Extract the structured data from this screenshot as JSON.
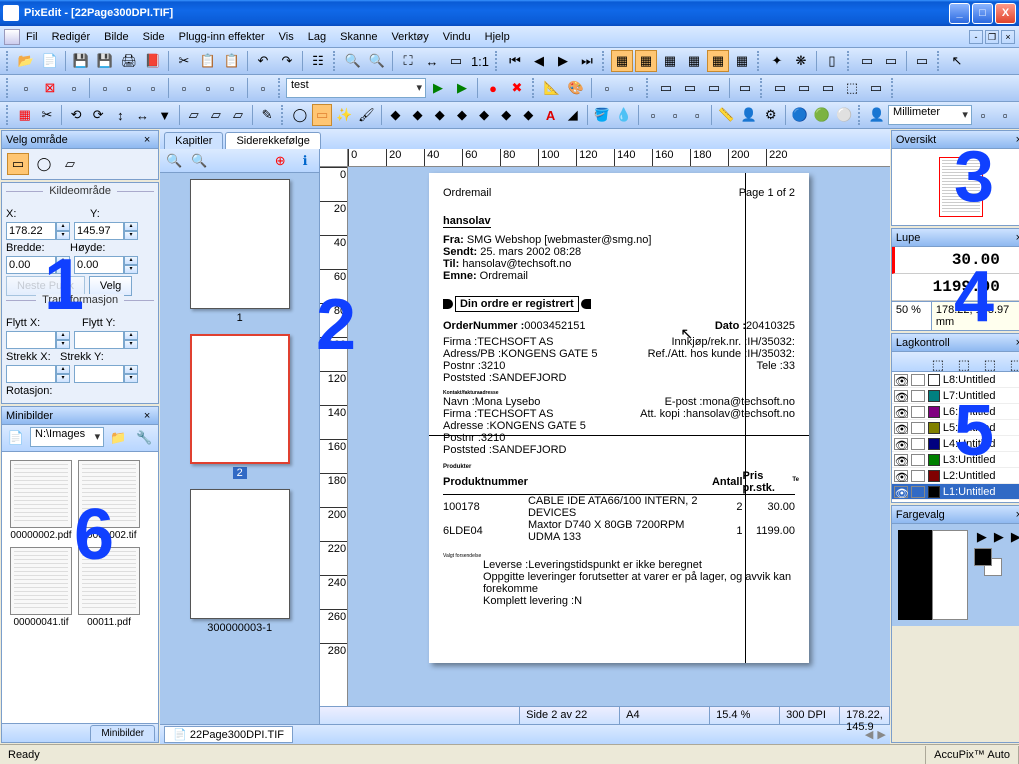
{
  "window": {
    "title": "PixEdit - [22Page300DPI.TIF]"
  },
  "menu": [
    "Fil",
    "Redigér",
    "Bilde",
    "Side",
    "Plugg-inn effekter",
    "Vis",
    "Lag",
    "Skanne",
    "Verktøy",
    "Vindu",
    "Hjelp"
  ],
  "toolbar3_combo": "test",
  "toolbar4_units": "Millimeter",
  "panels": {
    "selectarea": {
      "title": "Velg område"
    },
    "source": {
      "title": "Kildeområde",
      "x_label": "X:",
      "y_label": "Y:",
      "x": "178.22",
      "y": "145.97",
      "w_label": "Bredde:",
      "h_label": "Høyde:",
      "w": "0.00",
      "h": "0.00",
      "next": "Neste Punk",
      "pick": "Velg"
    },
    "transform": {
      "title": "Transformasjon",
      "fx_label": "Flytt X:",
      "fy_label": "Flytt Y:",
      "sx_label": "Strekk X:",
      "sy_label": "Strekk Y:",
      "rot_label": "Rotasjon:"
    },
    "minibilder": {
      "title": "Minibilder",
      "path": "N:\\Images",
      "files": [
        "00000002.pdf",
        "00000002.tif",
        "00000041.tif",
        "00011.pdf"
      ],
      "tab": "Minibilder"
    },
    "tabs": {
      "kapitler": "Kapitler",
      "siderekke": "Siderekkefølge"
    },
    "oversikt": {
      "title": "Oversikt"
    },
    "lupe": {
      "title": "Lupe",
      "v1": "30.00",
      "v2": "1199.00",
      "zoom": "50 %",
      "coord": "178.22, 145.97 mm"
    },
    "lagkontroll": {
      "title": "Lagkontroll",
      "layers": [
        {
          "name": "L8:Untitled",
          "color": "#ffffff"
        },
        {
          "name": "L7:Untitled",
          "color": "#008080"
        },
        {
          "name": "L6:Untitled",
          "color": "#800080"
        },
        {
          "name": "L5:Untitled",
          "color": "#808000"
        },
        {
          "name": "L4:Untitled",
          "color": "#000080"
        },
        {
          "name": "L3:Untitled",
          "color": "#008000"
        },
        {
          "name": "L2:Untitled",
          "color": "#800000"
        },
        {
          "name": "L1:Untitled",
          "color": "#000000"
        }
      ]
    },
    "fargevalg": {
      "title": "Fargevalg"
    }
  },
  "pagestrip": {
    "pages": [
      "1",
      "2",
      "300000003-1"
    ],
    "selected": 1
  },
  "document": {
    "header": {
      "title": "Ordremail",
      "page": "Page 1 of 2"
    },
    "to": "hansolav",
    "fields": [
      [
        "Fra:",
        "SMG Webshop [webmaster@smg.no]"
      ],
      [
        "Sendt:",
        "25. mars 2002 08:28"
      ],
      [
        "Til:",
        "hansolav@techsoft.no"
      ],
      [
        "Emne:",
        "Ordremail"
      ]
    ],
    "banner": "Din ordre er registrert",
    "ordernr_label": "OrderNummer :",
    "ordernr": "0003452151",
    "date_label": "Dato :",
    "date": "20410325",
    "firm_lines": [
      "Firma :TECHSOFT AS",
      "Adress/PB :KONGENS GATE 5",
      "Postnr :3210",
      "Poststed :SANDEFJORD"
    ],
    "ship_lines": [
      "Innkjøp/rek.nr. :IH/35032:",
      "Ref./Att. hos kunde :IH/35032:",
      "Tele :33"
    ],
    "contact": "Kontakt/fakturaadresse",
    "contact_lines": [
      "Navn :Mona Lysebo",
      "Firma :TECHSOFT AS",
      "Adresse :KONGENS GATE 5",
      "Postnr :3210",
      "Poststed :SANDEFJORD"
    ],
    "email_lines": [
      "E-post :mona@techsoft.no",
      "Att. kopi :hansolav@techsoft.no"
    ],
    "prod_hdr": [
      "Produktnummer",
      "",
      "Antall",
      "Pris pr.stk."
    ],
    "prod_rows": [
      [
        "100178",
        "CABLE IDE ATA66/100 INTERN, 2 DEVICES",
        "2",
        "30.00"
      ],
      [
        "6LDE04",
        "Maxtor D740 X 80GB 7200RPM UDMA 133",
        "1",
        "1199.00"
      ]
    ],
    "delivery_label": "Valgt forsendelse",
    "delivery_lines": [
      "Leverse :Leveringstidspunkt er ikke beregnet",
      "Oppgitte leveringer forutsetter at varer er på lager, og avvik kan forekomme",
      "Komplett levering :N"
    ],
    "te": "Te"
  },
  "docstatus": {
    "page": "Side 2 av 22",
    "format": "A4",
    "zoom": "15.4 %",
    "dpi": "300 DPI",
    "coord": "178.22, 145.9"
  },
  "doctab": "22Page300DPI.TIF",
  "status": {
    "ready": "Ready",
    "accupix": "AccuPix™ Auto"
  },
  "ruler_h": [
    0,
    20,
    40,
    60,
    80,
    100,
    120,
    140,
    160,
    180,
    200,
    220
  ],
  "ruler_v": [
    0,
    20,
    40,
    60,
    80,
    100,
    120,
    140,
    160,
    180,
    200,
    220,
    240,
    260,
    280
  ]
}
